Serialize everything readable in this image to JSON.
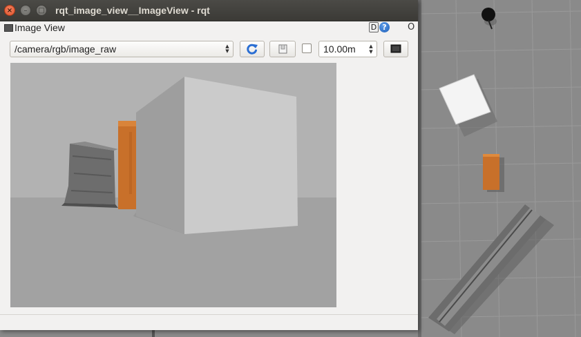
{
  "window": {
    "title": "rqt_image_view__ImageView - rqt",
    "close_glyph": "×",
    "minimize_glyph": "–",
    "maximize_glyph": "□"
  },
  "plugin": {
    "title": "Image View",
    "dock_label": "D",
    "help_label": "?",
    "close_label": "O"
  },
  "toolbar": {
    "topic": "/camera/rgb/image_raw",
    "zoom": "10.00m",
    "smooth_checked": false,
    "icons": {
      "refresh": "refresh-icon",
      "save": "save-icon",
      "dark": "display-icon"
    }
  },
  "colors": {
    "titlebar": "#3c3b37",
    "window_bg": "#f2f1f0",
    "refresh_blue": "#2a6ed3",
    "box_orange": "#c8702a",
    "sky_gray": "#b2b2b2",
    "ground_gray": "#a2a2a2"
  }
}
